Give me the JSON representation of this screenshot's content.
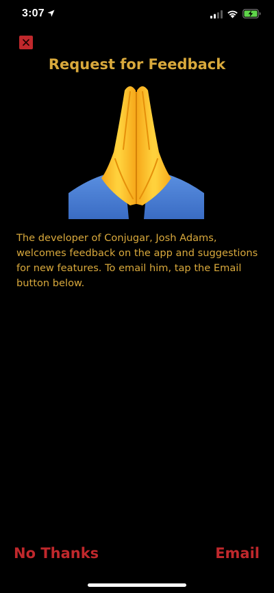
{
  "status_bar": {
    "time": "3:07",
    "location_icon": "location-arrow-icon",
    "signal_icon": "cellular-signal-icon",
    "wifi_icon": "wifi-icon",
    "battery_icon": "battery-charging-icon"
  },
  "dialog": {
    "close_icon": "close-icon",
    "title": "Request for Feedback",
    "illustration": "folded-hands-icon",
    "body": "The developer of Conjugar, Josh Adams, welcomes feedback on the app and suggestions for new features. To email him, tap the Email button below."
  },
  "actions": {
    "no_thanks_label": "No Thanks",
    "email_label": "Email"
  },
  "colors": {
    "background": "#000000",
    "accent_gold": "#d9a93c",
    "accent_red": "#c0282c",
    "battery_green": "#5fd44a"
  }
}
